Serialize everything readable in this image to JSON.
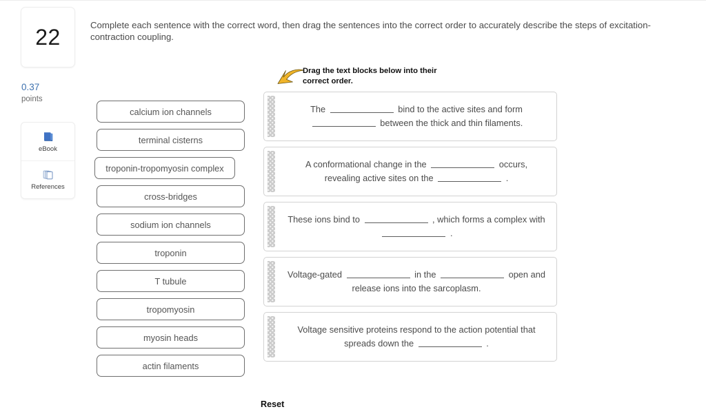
{
  "question": {
    "number": "22",
    "points_value": "0.37",
    "points_label": "points",
    "stem": "Complete each sentence with the correct word, then drag the sentences into the correct order to accurately describe the steps of excitation-contraction coupling."
  },
  "tools": [
    {
      "label": "eBook",
      "icon": "book-icon"
    },
    {
      "label": "References",
      "icon": "pages-icon"
    }
  ],
  "word_bank": [
    {
      "label": "calcium ion channels"
    },
    {
      "label": "terminal cisterns"
    },
    {
      "label": "troponin-tropomyosin complex"
    },
    {
      "label": "cross-bridges"
    },
    {
      "label": "sodium ion channels"
    },
    {
      "label": "troponin"
    },
    {
      "label": "T tubule"
    },
    {
      "label": "tropomyosin"
    },
    {
      "label": "myosin heads"
    },
    {
      "label": "actin filaments"
    }
  ],
  "drag_hint": {
    "text": "Drag the text blocks below into their correct order.",
    "arrow_icon": "curved-arrow-icon",
    "arrow_color": "#f0b429"
  },
  "sentences": [
    {
      "id": "sentence-1",
      "segments": [
        "The ",
        "BLANK",
        " bind to the active sites and form ",
        "BLANK",
        " between the thick and thin filaments."
      ]
    },
    {
      "id": "sentence-2",
      "segments": [
        "A conformational change in the ",
        "BLANK",
        " occurs, revealing active sites on the ",
        "BLANK",
        " ."
      ]
    },
    {
      "id": "sentence-3",
      "segments": [
        "These ions bind to ",
        "BLANK",
        " , which forms a complex with ",
        "BLANK",
        " ."
      ]
    },
    {
      "id": "sentence-4",
      "segments": [
        "Voltage-gated ",
        "BLANK",
        " in the ",
        "BLANK",
        " open and release ions into the sarcoplasm."
      ]
    },
    {
      "id": "sentence-5",
      "segments": [
        "Voltage sensitive proteins respond to the action potential that spreads down the ",
        "BLANK",
        " ."
      ]
    }
  ],
  "reset": {
    "label": "Reset"
  },
  "colors": {
    "points_blue": "#3f72af",
    "chip_border": "#6e6e6e",
    "block_border": "#d2d2d2",
    "arrow_gold": "#f0b429"
  }
}
